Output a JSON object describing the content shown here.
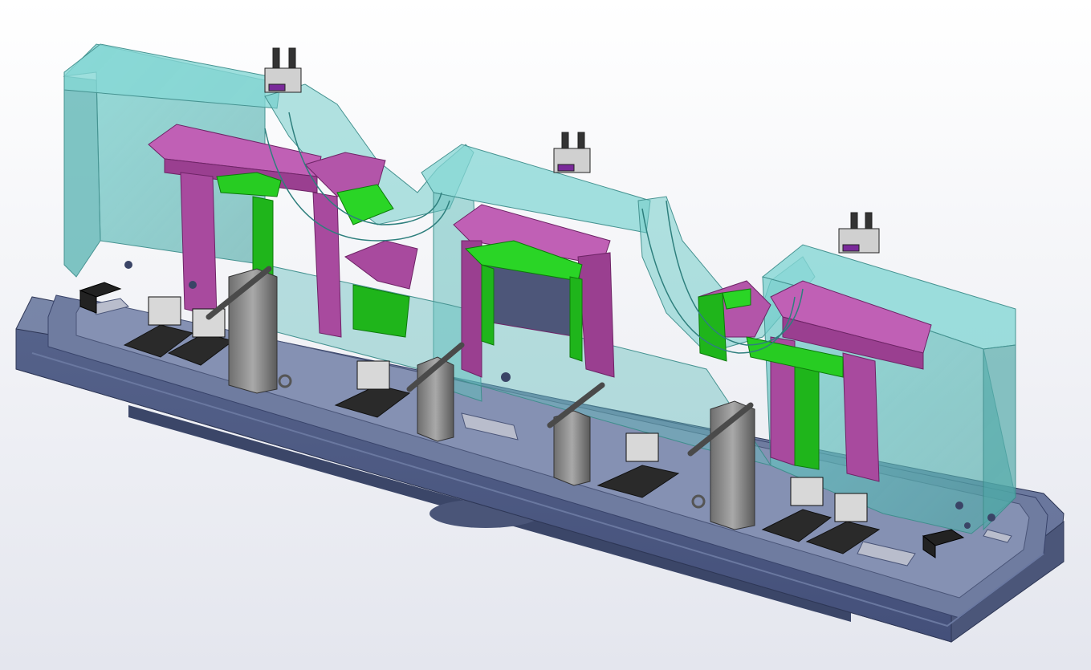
{
  "scene": {
    "kind": "cad-render",
    "background": {
      "top": "#ffffff",
      "bottom": "#e4e6ee"
    },
    "colors": {
      "base_plate": "#5d6a8e",
      "base_plate_dark": "#3f4a69",
      "base_plate_light": "#7c88aa",
      "transparent_block": "#66c3c0",
      "magenta_part": "#b04ca6",
      "green_part": "#1ec51a",
      "steel": "#8a8a8a",
      "steel_dark": "#4a4a4a",
      "clamp_black": "#2a2a2a",
      "slot_face": "#b9b9c3"
    }
  }
}
